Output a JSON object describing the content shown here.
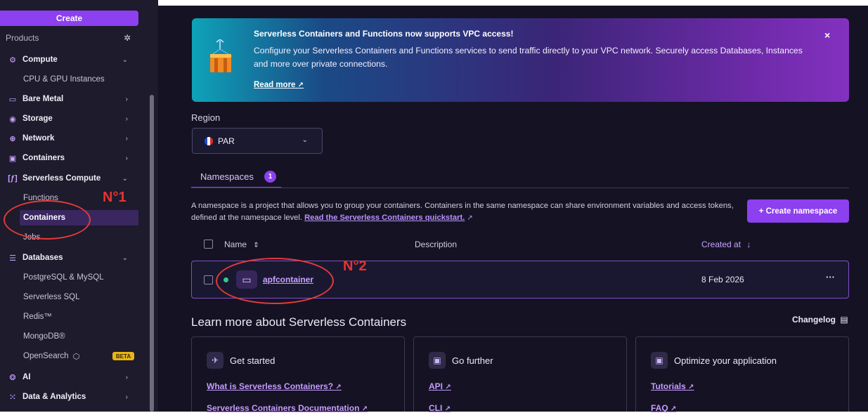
{
  "sidebar": {
    "create_label": "Create",
    "products_label": "Products",
    "settings_icon": "gear-icon",
    "items": [
      {
        "label": "Compute",
        "icon": "chip-icon",
        "chevron": "⌄"
      },
      {
        "label": "CPU & GPU Instances"
      },
      {
        "label": "Bare Metal",
        "icon": "server-icon",
        "chevron": "›"
      },
      {
        "label": "Storage",
        "icon": "disk-icon",
        "chevron": "›"
      },
      {
        "label": "Network",
        "icon": "globe-icon",
        "chevron": "›"
      },
      {
        "label": "Containers",
        "icon": "container-icon",
        "chevron": "›"
      },
      {
        "label": "Serverless Compute",
        "icon": "function-icon",
        "chevron": "⌄"
      },
      {
        "label": "Functions"
      },
      {
        "label": "Containers"
      },
      {
        "label": "Jobs"
      },
      {
        "label": "Databases",
        "icon": "database-icon",
        "chevron": "⌄"
      },
      {
        "label": "PostgreSQL & MySQL"
      },
      {
        "label": "Serverless SQL"
      },
      {
        "label": "Redis™"
      },
      {
        "label": "MongoDB®"
      },
      {
        "label": "OpenSearch",
        "badge": "BETA"
      },
      {
        "label": "AI",
        "icon": "ai-icon",
        "chevron": "›"
      },
      {
        "label": "Data & Analytics",
        "icon": "analytics-icon",
        "chevron": "›"
      }
    ]
  },
  "banner": {
    "title": "Serverless Containers and Functions now supports VPC access!",
    "text": "Configure your Serverless Containers and Functions services to send traffic directly to your VPC network. Securely access Databases, Instances and more over private connections.",
    "link": "Read more",
    "close": "×"
  },
  "region": {
    "label": "Region",
    "value": "PAR"
  },
  "tabs": [
    {
      "label": "Namespaces",
      "count": "1"
    }
  ],
  "namespaces": {
    "description": "A namespace is a project that allows you to group your containers. Containers in the same namespace can share environment variables and access tokens, defined at the namespace level.",
    "quickstart_link": "Read the Serverless Containers quickstart.",
    "create_button": "+ Create namespace",
    "columns": {
      "name": "Name",
      "description": "Description",
      "created_at": "Created at"
    },
    "rows": [
      {
        "name": "apfcontainer",
        "description": "",
        "created_at": "8 Feb 2026",
        "more": "···",
        "status": "active"
      }
    ]
  },
  "learn": {
    "title": "Learn more about Serverless Containers",
    "changelog": "Changelog",
    "cards": [
      {
        "title": "Get started",
        "icon": "rocket-icon",
        "links": [
          "What is Serverless Containers?",
          "Serverless Containers Documentation"
        ]
      },
      {
        "title": "Go further",
        "icon": "container-icon",
        "links": [
          "API",
          "CLI"
        ]
      },
      {
        "title": "Optimize your application",
        "icon": "container-icon",
        "links": [
          "Tutorials",
          "FAQ"
        ]
      }
    ]
  },
  "annotations": {
    "label1": "N°1",
    "label2": "N°2",
    "color": "#e33a3a"
  },
  "colors": {
    "accent": "#8c40ef",
    "sidebar_bg": "#1d1b2c",
    "main_bg": "#151323",
    "beta_badge": "#e8b417"
  }
}
